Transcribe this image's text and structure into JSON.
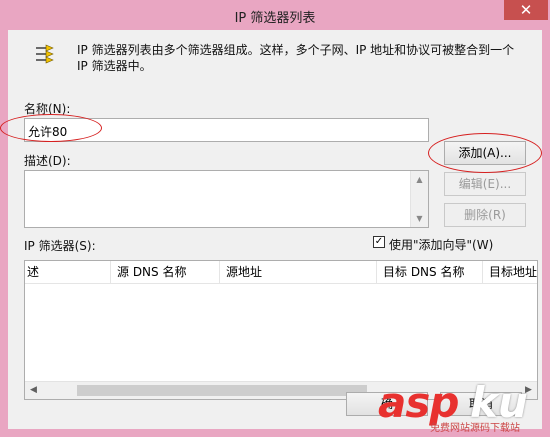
{
  "window": {
    "title": "IP 筛选器列表",
    "close_glyph": "✕"
  },
  "intro": {
    "text": "IP 筛选器列表由多个筛选器组成。这样，多个子网、IP 地址和协议可被整合到一个 IP 筛选器中。"
  },
  "name": {
    "label": "名称(N):",
    "value": "允许80"
  },
  "description": {
    "label": "描述(D):",
    "value": ""
  },
  "buttons": {
    "add": "添加(A)...",
    "edit": "编辑(E)...",
    "remove": "删除(R)",
    "ok": "确",
    "cancel": "取消"
  },
  "filters": {
    "label": "IP 筛选器(S):",
    "wizard_label": "使用\"添加向导\"(W)",
    "wizard_checked": true,
    "columns": [
      "述",
      "源 DNS 名称",
      "源地址",
      "目标 DNS 名称",
      "目标地址"
    ],
    "rows": []
  },
  "colors": {
    "accent_red": "#d62020",
    "title_bg": "#e9a6c2"
  },
  "watermark": {
    "brand_a": "asp",
    "brand_b": "ku",
    "sub": "免费网站源码下载站"
  }
}
